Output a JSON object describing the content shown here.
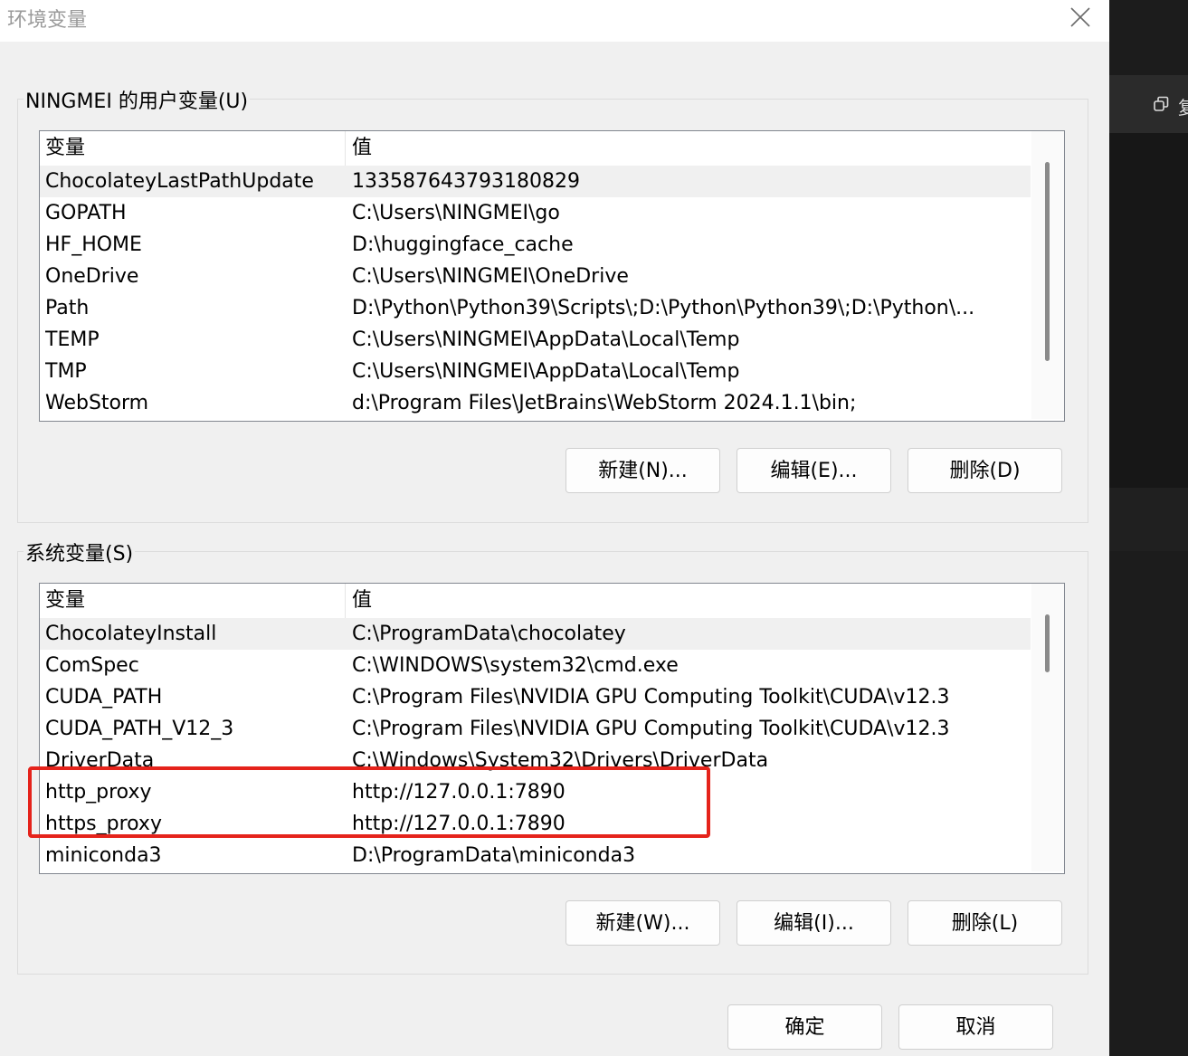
{
  "dialog": {
    "title": "环境变量",
    "close_icon": "close-icon"
  },
  "user_vars": {
    "legend": "NINGMEI 的用户变量(U)",
    "header_name": "变量",
    "header_value": "值",
    "rows": [
      {
        "name": "ChocolateyLastPathUpdate",
        "value": "133587643793180829"
      },
      {
        "name": "GOPATH",
        "value": "C:\\Users\\NINGMEI\\go"
      },
      {
        "name": "HF_HOME",
        "value": "D:\\huggingface_cache"
      },
      {
        "name": "OneDrive",
        "value": "C:\\Users\\NINGMEI\\OneDrive"
      },
      {
        "name": "Path",
        "value": "D:\\Python\\Python39\\Scripts\\;D:\\Python\\Python39\\;D:\\Python\\..."
      },
      {
        "name": "TEMP",
        "value": "C:\\Users\\NINGMEI\\AppData\\Local\\Temp"
      },
      {
        "name": "TMP",
        "value": "C:\\Users\\NINGMEI\\AppData\\Local\\Temp"
      },
      {
        "name": "WebStorm",
        "value": "d:\\Program Files\\JetBrains\\WebStorm 2024.1.1\\bin;"
      }
    ],
    "buttons": {
      "new": "新建(N)...",
      "edit": "编辑(E)...",
      "delete": "删除(D)"
    }
  },
  "system_vars": {
    "legend": "系统变量(S)",
    "header_name": "变量",
    "header_value": "值",
    "rows": [
      {
        "name": "ChocolateyInstall",
        "value": "C:\\ProgramData\\chocolatey"
      },
      {
        "name": "ComSpec",
        "value": "C:\\WINDOWS\\system32\\cmd.exe"
      },
      {
        "name": "CUDA_PATH",
        "value": "C:\\Program Files\\NVIDIA GPU Computing Toolkit\\CUDA\\v12.3"
      },
      {
        "name": "CUDA_PATH_V12_3",
        "value": "C:\\Program Files\\NVIDIA GPU Computing Toolkit\\CUDA\\v12.3"
      },
      {
        "name": "DriverData",
        "value": "C:\\Windows\\System32\\Drivers\\DriverData"
      },
      {
        "name": "http_proxy",
        "value": "http://127.0.0.1:7890"
      },
      {
        "name": "https_proxy",
        "value": "http://127.0.0.1:7890"
      },
      {
        "name": "miniconda3",
        "value": "D:\\ProgramData\\miniconda3"
      }
    ],
    "buttons": {
      "new": "新建(W)...",
      "edit": "编辑(I)...",
      "delete": "删除(L)"
    }
  },
  "footer": {
    "ok": "确定",
    "cancel": "取消"
  },
  "background_window": {
    "text": "复",
    "icon": "restore-icon"
  },
  "colors": {
    "highlight": "#e5231b",
    "selected_row": "#f0f0f0"
  }
}
